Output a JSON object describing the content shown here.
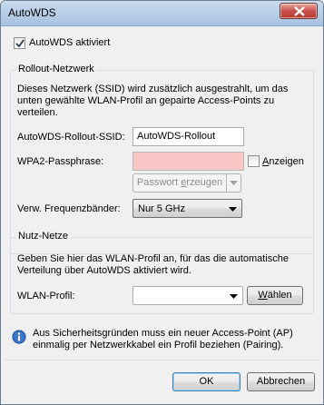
{
  "window": {
    "title": "AutoWDS"
  },
  "autowds": {
    "enabled_label": "AutoWDS aktiviert",
    "enabled": true
  },
  "rollout": {
    "group_title": "Rollout-Netzwerk",
    "description": "Dieses Netzwerk (SSID) wird zusätzlich ausgestrahlt, um das unten gewählte WLAN-Profil an gepairte Access-Points zu verteilen.",
    "ssid_label": "AutoWDS-Rollout-SSID:",
    "ssid_value": "AutoWDS-Rollout",
    "passphrase_label": "WPA2-Passphrase:",
    "passphrase_value": "",
    "show_label": "Anzeigen",
    "generate_label": "Passwort erzeugen",
    "freq_label": "Verw. Frequenzbänder:",
    "freq_value": "Nur 5 GHz"
  },
  "nutz": {
    "group_title": "Nutz-Netze",
    "description": "Geben Sie hier das WLAN-Profil an, für das die automatische Verteilung über AutoWDS aktiviert wird.",
    "profile_label": "WLAN-Profil:",
    "profile_value": "",
    "choose_label": "Wählen"
  },
  "info": {
    "text": "Aus Sicherheitsgründen muss ein neuer Access-Point (AP) einmalig per Netzwerkkabel ein Profil beziehen (Pairing)."
  },
  "buttons": {
    "ok": "OK",
    "cancel": "Abbrechen"
  },
  "colors": {
    "error_field": "#f9c6c6",
    "titlebar": "#b4cbe6",
    "close": "#c75050"
  }
}
